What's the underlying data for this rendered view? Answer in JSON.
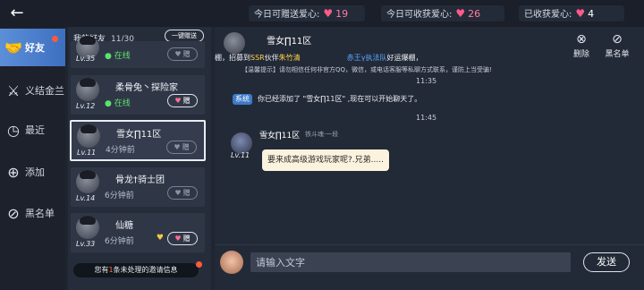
{
  "topbar": {
    "stats": [
      {
        "label": "今日可赠送爱心:",
        "value": "19"
      },
      {
        "label": "今日可收获爱心:",
        "value": "26"
      },
      {
        "label": "已收获爱心:",
        "value": "4"
      }
    ]
  },
  "nav": {
    "items": [
      {
        "label": "好友",
        "icon": "handshake-icon"
      },
      {
        "label": "义结金兰",
        "icon": "oath-icon"
      },
      {
        "label": "最近",
        "icon": "recent-user-icon"
      },
      {
        "label": "添加",
        "icon": "add-user-icon"
      },
      {
        "label": "黑名单",
        "icon": "block-icon"
      }
    ]
  },
  "friends": {
    "title": "我的好友",
    "count": "11/30",
    "gift_all_label": "一键赠送",
    "items": [
      {
        "name": "",
        "level": "Lv.35",
        "status": "在线",
        "online": true,
        "gift": "赠",
        "gift_enabled": false
      },
      {
        "name": "柔骨兔丶探险家",
        "level": "Lv.12",
        "status": "在线",
        "online": true,
        "gift": "赠",
        "gift_enabled": true
      },
      {
        "name": "雪女∏11区",
        "level": "Lv.11",
        "status": "4分钟前",
        "online": false,
        "gift": "赠",
        "gift_enabled": false
      },
      {
        "name": "骨龙†骑士团",
        "level": "Lv.14",
        "status": "6分钟前",
        "online": false,
        "gift": "赠",
        "gift_enabled": false
      },
      {
        "name": "仙糖",
        "level": "Lv.33",
        "status": "6分钟前",
        "online": false,
        "gift": "赠",
        "gift_enabled": true
      }
    ],
    "invite_prefix": "您有",
    "invite_count": "1",
    "invite_suffix": "条未处理的邀请信息"
  },
  "chat": {
    "header_name": "雪女∏11区",
    "delete_label": "删除",
    "blacklist_label": "黑名单",
    "marquee_a": "棚，招募到",
    "marquee_hl": "SSR",
    "marquee_b": "伙伴",
    "marquee_partner": "朱竹清",
    "marquee_team": "赤王γ执法队",
    "marquee_tail": "好运爆棚，",
    "warning": "【温馨提示】请勿相信任何非官方QQ，微信，或电话客服等私聊方式联系，谨防上当受骗!",
    "time1": "11:35",
    "system_tag": "系统",
    "system_msg": "你已经添加了 \"雪女∏11区\" ,现在可以开始聊天了。",
    "time2": "11:45",
    "sender_name": "雪女∏11区",
    "sender_title": "铁斗魂·一段",
    "sender_level": "Lv.11",
    "message": "要来成高级游戏玩家呢?.兄弟.....",
    "input_placeholder": "请输入文字",
    "send_label": "发送"
  }
}
